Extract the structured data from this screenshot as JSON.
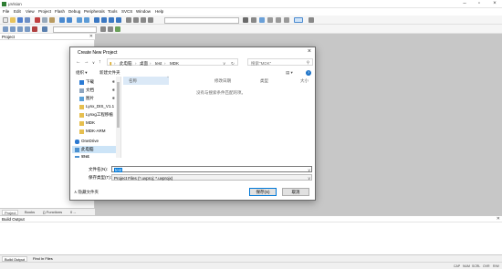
{
  "window": {
    "title": "μVision"
  },
  "menu": [
    "File",
    "Edit",
    "View",
    "Project",
    "Flash",
    "Debug",
    "Peripherals",
    "Tools",
    "SVCS",
    "Window",
    "Help"
  ],
  "project_pane": {
    "title": "Project",
    "tabs": [
      "Project",
      "Books",
      "{} Functions",
      "0→ Templates"
    ]
  },
  "build_pane": {
    "title": "Build Output",
    "tabs": [
      "Build Output",
      "Find In Files"
    ]
  },
  "status": {
    "caps": "CAP",
    "num": "NUM",
    "scrl": "SCRL",
    "ovr": "OVR",
    "rw": "R/W"
  },
  "dialog": {
    "title": "Create New Project",
    "path": [
      "此电脑",
      "桌面",
      "test",
      "MDK"
    ],
    "search_placeholder": "搜索\"MDK\"",
    "organize": "组织 ▾",
    "new_folder": "新建文件夹",
    "nav": [
      {
        "label": "下载",
        "icon": "download-icon",
        "pinned": true
      },
      {
        "label": "文档",
        "icon": "document-icon",
        "pinned": true
      },
      {
        "label": "图片",
        "icon": "picture-icon",
        "pinned": true
      },
      {
        "label": "Lynx_DIS_V1.1",
        "icon": "folder-icon",
        "pinned": false
      },
      {
        "label": "Lynxg工程移植",
        "icon": "folder-icon",
        "pinned": false
      },
      {
        "label": "MDK",
        "icon": "folder-icon",
        "pinned": false
      },
      {
        "label": "MDK-ARM",
        "icon": "folder-icon",
        "pinned": false
      },
      {
        "label": "OneDrive",
        "icon": "cloud-icon",
        "pinned": false
      },
      {
        "label": "此电脑",
        "icon": "computer-icon",
        "pinned": false
      },
      {
        "label": "网络",
        "icon": "network-icon",
        "pinned": false
      }
    ],
    "columns": [
      "名称",
      "修改日期",
      "类型",
      "大小"
    ],
    "empty_text": "没有与搜索条件匹配的项。",
    "filename_label": "文件名(N):",
    "filename_value": "test",
    "savetype_label": "保存类型(T):",
    "savetype_value": "Project Files (*.uvproj; *.uvprojx)",
    "hide_folders": "隐藏文件夹",
    "save_button": "保存(S)",
    "cancel_button": "取消"
  }
}
